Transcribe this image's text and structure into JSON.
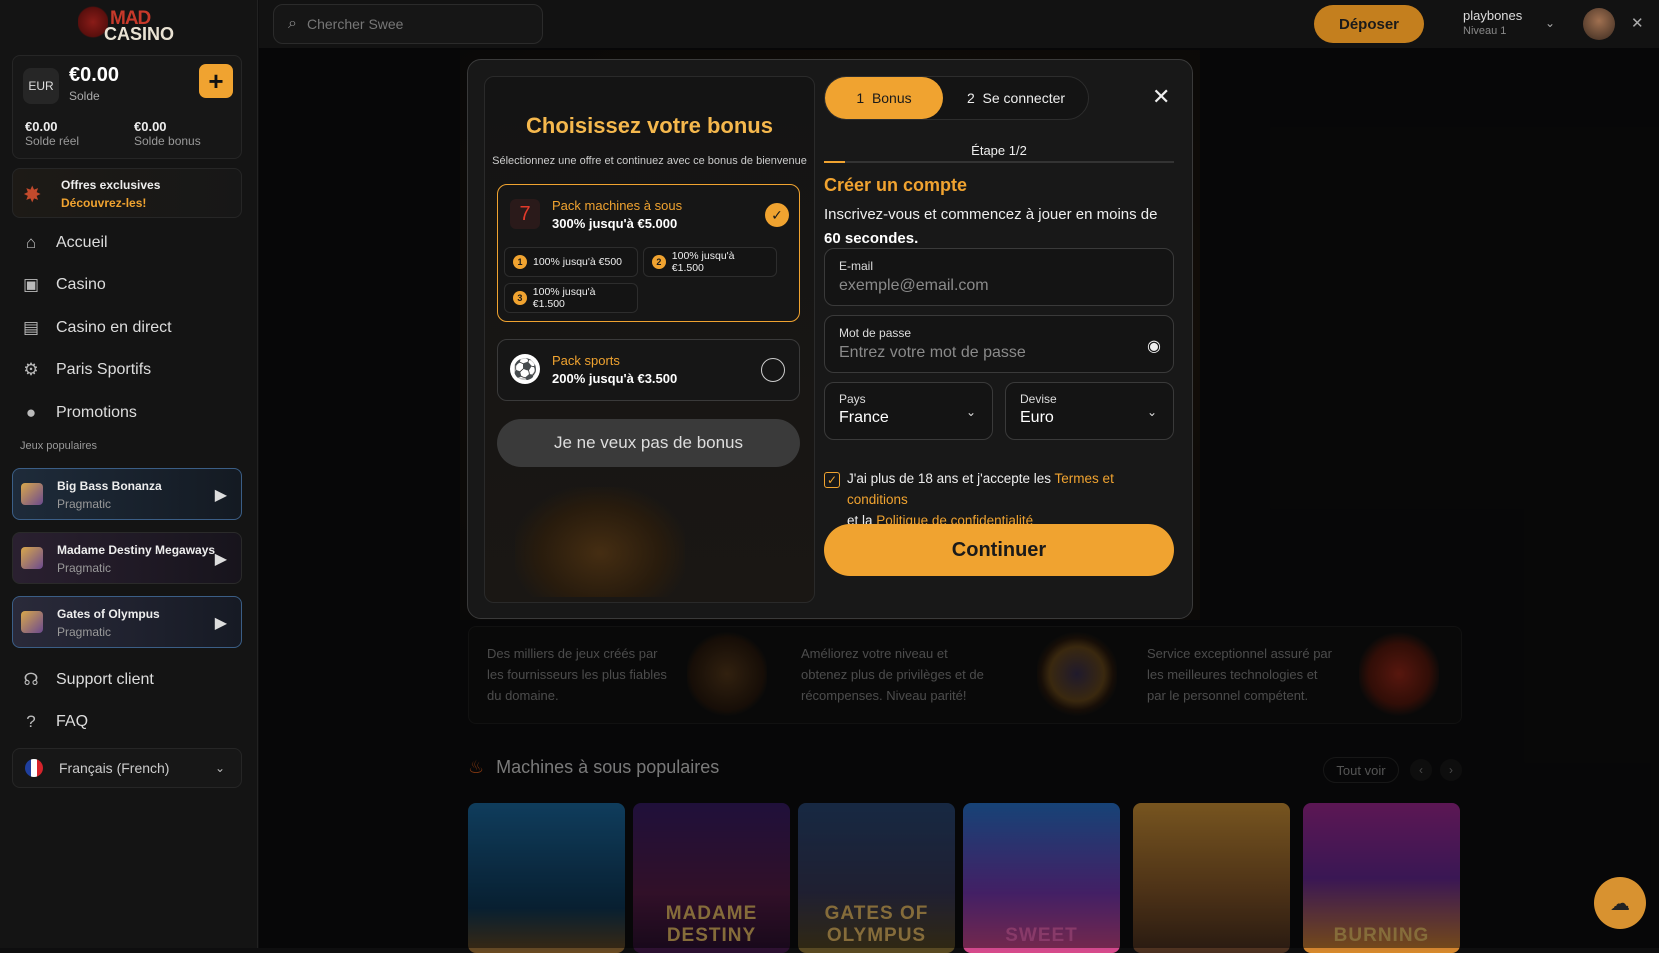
{
  "logo": {
    "line1": "MAD",
    "line2": "CASINO"
  },
  "balance": {
    "currency": "EUR",
    "amount": "€0.00",
    "label": "Solde",
    "real_amount": "€0.00",
    "real_label": "Solde réel",
    "bonus_amount": "€0.00",
    "bonus_label": "Solde bonus",
    "add_icon": "plus-icon"
  },
  "offers": {
    "title": "Offres exclusives",
    "cta": "Découvrez-les!"
  },
  "nav": [
    {
      "label": "Accueil",
      "icon": "home-icon"
    },
    {
      "label": "Casino",
      "icon": "casino-icon"
    },
    {
      "label": "Casino en direct",
      "icon": "live-icon"
    },
    {
      "label": "Paris Sportifs",
      "icon": "sports-icon"
    },
    {
      "label": "Promotions",
      "icon": "promo-icon"
    }
  ],
  "popular_games_label": "Jeux populaires",
  "sidebar_games": [
    {
      "name": "Big Bass Bonanza",
      "provider": "Pragmatic"
    },
    {
      "name": "Madame Destiny Megaways",
      "provider": "Pragmatic"
    },
    {
      "name": "Gates of Olympus",
      "provider": "Pragmatic"
    }
  ],
  "support": {
    "label": "Support client"
  },
  "faq": {
    "label": "FAQ"
  },
  "language": {
    "label": "Français (French)"
  },
  "topbar": {
    "search_placeholder": "Chercher Swee",
    "deposit": "Déposer",
    "username": "playbones",
    "level": "Niveau 1"
  },
  "modal": {
    "bonus_title": "Choisissez votre bonus",
    "bonus_subtitle": "Sélectionnez une offre et continuez avec ce bonus de bienvenue",
    "packs": [
      {
        "name": "Pack machines à sous",
        "value": "300% jusqu'à €5.000",
        "selected": true
      },
      {
        "name": "Pack sports",
        "value": "200% jusqu'à €3.500",
        "selected": false
      }
    ],
    "tiers": [
      {
        "n": "1",
        "label": "100% jusqu'à €500"
      },
      {
        "n": "2",
        "label": "100% jusqu'à €1.500"
      },
      {
        "n": "3",
        "label": "100% jusqu'à €1.500"
      }
    ],
    "no_bonus": "Je ne veux pas de bonus",
    "steps": [
      {
        "n": "1",
        "label": "Bonus"
      },
      {
        "n": "2",
        "label": "Se connecter"
      }
    ],
    "step_label": "Étape 1/2",
    "step_progress": 0.06,
    "create_title": "Créer un compte",
    "create_desc_a": "Inscrivez-vous et commencez à jouer en moins de",
    "create_desc_b": "60 secondes",
    "create_desc_c": ".",
    "email_label": "E-mail",
    "email_placeholder": "exemple@email.com",
    "password_label": "Mot de passe",
    "password_placeholder": "Entrez votre mot de passe",
    "country_label": "Pays",
    "country_value": "France",
    "currency_label": "Devise",
    "currency_value": "Euro",
    "terms_a": "J'ai plus de 18 ans et j'accepte les",
    "terms_link": "Termes et conditions",
    "terms_b": "et la",
    "privacy_link": "Politique de confidentialité",
    "continue": "Continuer"
  },
  "features": [
    "Des milliers de jeux créés par les fournisseurs les plus fiables du domaine.",
    "Améliorez votre niveau et obtenez plus de privilèges et de récompenses. Niveau parité!",
    "Service exceptionnel assuré par les meilleures technologies et par le personnel compétent."
  ],
  "popular_slots": {
    "title": "Machines à sous populaires",
    "see_all": "Tout voir"
  },
  "tiles": [
    "",
    "MADAME DESTINY",
    "GATES OF OLYMPUS",
    "SWEET",
    "",
    "BURNING"
  ],
  "colors": {
    "accent": "#f0a330",
    "background": "#0e0e0f"
  }
}
